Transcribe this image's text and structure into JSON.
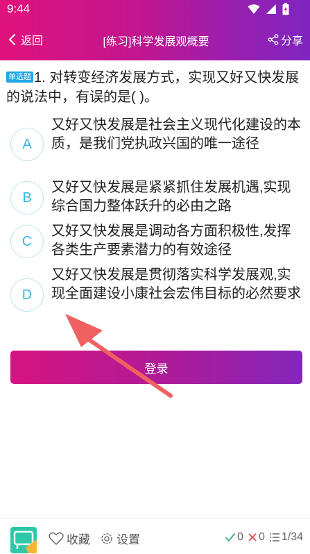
{
  "status_bar": {
    "time": "9:44"
  },
  "nav": {
    "back_label": "返回",
    "title": "[练习]科学发展观概要",
    "share_label": "分享"
  },
  "question": {
    "type_badge": "单选题",
    "text": "1. 对转变经济发展方式，实现又好又快发展的说法中，有误的是( )。"
  },
  "options": [
    {
      "letter": "A",
      "text": "又好又快发展是社会主义现代化建设的本质，是我们党执政兴国的唯一途径"
    },
    {
      "letter": "B",
      "text": "又好又快发展是紧紧抓住发展机遇,实现综合国力整体跃升的必由之路"
    },
    {
      "letter": "C",
      "text": "又好又快发展是调动各方面积极性,发挥各类生产要素潜力的有效途径"
    },
    {
      "letter": "D",
      "text": "又好又快发展是贯彻落实科学发展观,实现全面建设小康社会宏伟目标的必然要求"
    }
  ],
  "login_button": "登录",
  "bottom": {
    "favorite_label": "收藏",
    "settings_label": "设置",
    "correct_count": "0",
    "wrong_count": "0",
    "progress": "1/34"
  },
  "colors": {
    "header_gradient_start": "#e0127d",
    "header_gradient_end": "#7e25c0",
    "option_accent": "#38b6e4",
    "badge": "#22a6e6",
    "arrow": "#f06060"
  }
}
